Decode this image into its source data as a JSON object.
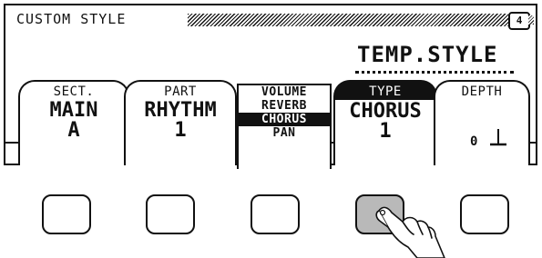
{
  "screen": {
    "title": "CUSTOM STYLE",
    "page_number": "4",
    "style_name": "TEMP.STYLE"
  },
  "tabs": [
    {
      "label": "SECT.",
      "value": "MAIN",
      "sub": "A"
    },
    {
      "label": "PART",
      "value": "RHYTHM",
      "sub": "1"
    },
    {
      "label": "TYPE",
      "value": "CHORUS",
      "sub": "1"
    },
    {
      "label": "DEPTH",
      "value": "0"
    }
  ],
  "effect_list": {
    "items": [
      "VOLUME",
      "REVERB",
      "CHORUS",
      "PAN"
    ],
    "selected": "CHORUS"
  },
  "buttons": {
    "count": 5,
    "pressed_index": 3
  },
  "icons": {
    "depth_slider": "slider-icon",
    "pointer": "pointing-hand-icon"
  }
}
